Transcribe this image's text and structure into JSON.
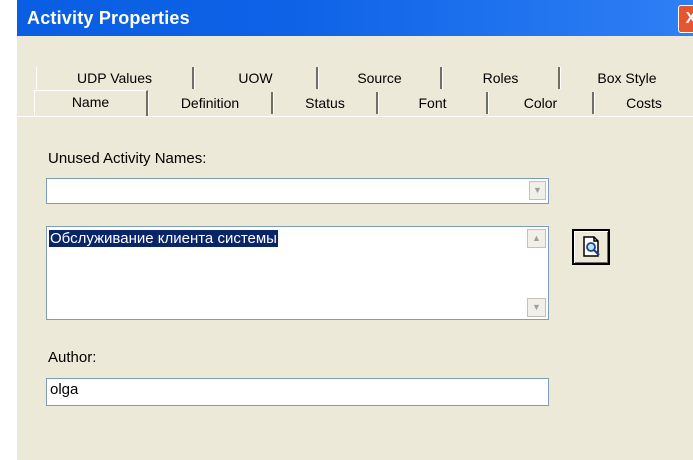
{
  "window": {
    "title": "Activity Properties",
    "close_glyph": "X"
  },
  "tabs": {
    "row_top": [
      "UDP Values",
      "UOW",
      "Source",
      "Roles",
      "Box Style"
    ],
    "row_bottom": [
      "Name",
      "Definition",
      "Status",
      "Font",
      "Color",
      "Costs"
    ],
    "active": "Name"
  },
  "form": {
    "unused_names_label": "Unused Activity Names:",
    "unused_names_value": "",
    "activity_name": "Обслуживание клиента системы",
    "author_label": "Author:",
    "author_value": "olga"
  },
  "icons": {
    "browse": "magnifier-document-icon",
    "dropdown": "chevron-down-icon",
    "scroll_up": "chevron-up-icon",
    "scroll_down": "chevron-down-icon"
  },
  "colors": {
    "titlebar": "#0a5ee3",
    "dialog_bg": "#ece9d8",
    "selection": "#0a246a",
    "close_button": "#e8552d"
  }
}
